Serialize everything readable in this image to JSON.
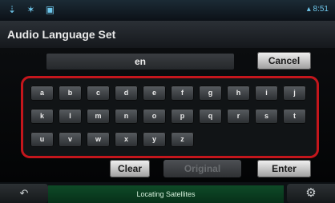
{
  "status_bar": {
    "left_icons": "⇣ ✶ ▣",
    "right_text": "▴ 8:51"
  },
  "header": {
    "title": "Audio Language Set"
  },
  "language_field": {
    "value": "en"
  },
  "buttons": {
    "cancel": "Cancel",
    "clear": "Clear",
    "original": "Original",
    "enter": "Enter"
  },
  "keyboard": {
    "rows": [
      [
        "a",
        "b",
        "c",
        "d",
        "e",
        "f",
        "g",
        "h",
        "i",
        "j"
      ],
      [
        "k",
        "l",
        "m",
        "n",
        "o",
        "p",
        "q",
        "r",
        "s",
        "t"
      ],
      [
        "u",
        "v",
        "w",
        "x",
        "y",
        "z"
      ]
    ]
  },
  "footer": {
    "back_icon": "↶",
    "status_text": "Locating Satellites",
    "settings_icon": "⚙"
  },
  "colors": {
    "highlight": "#c4161c",
    "status_strip": "#0e4a27"
  }
}
